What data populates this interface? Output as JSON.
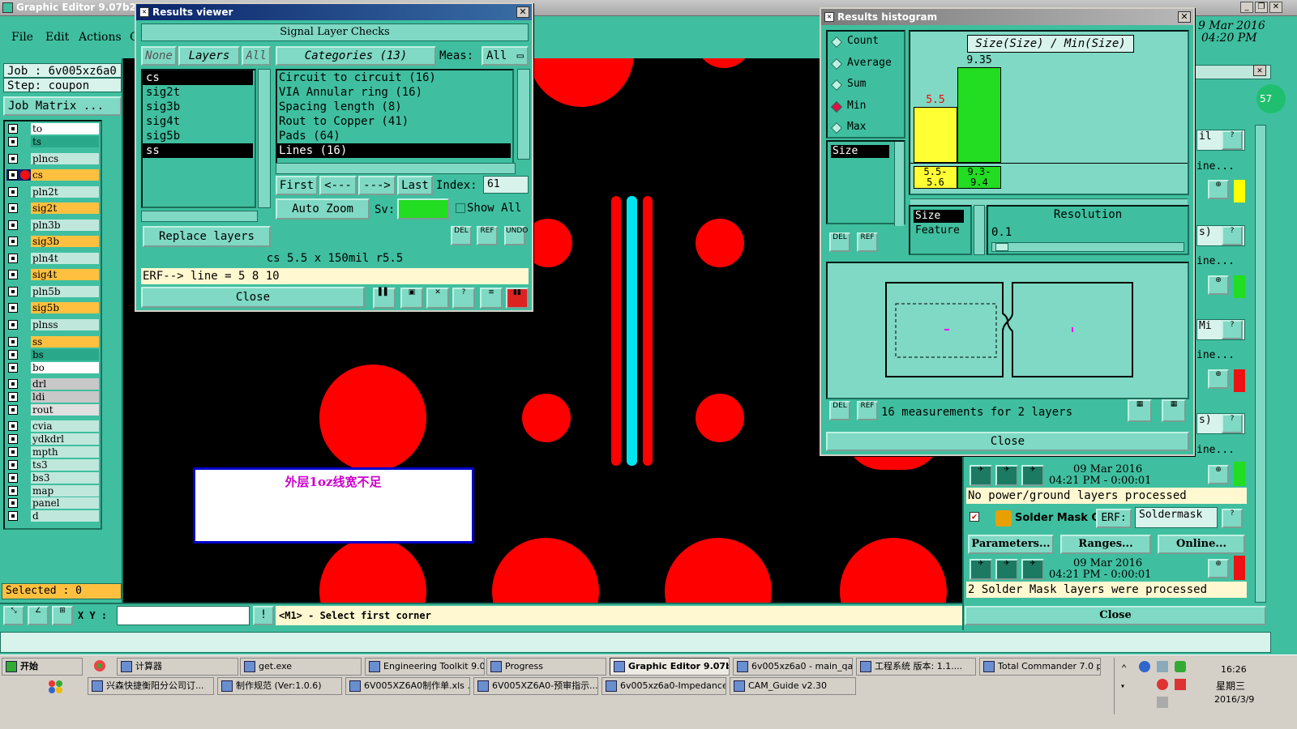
{
  "app": {
    "title": "Graphic Editor 9.07b2 (008",
    "menu": [
      "File",
      "Edit",
      "Actions",
      "C"
    ],
    "date": "9 Mar 2016",
    "time": "04:20 PM"
  },
  "left_panel": {
    "job": "Job : 6v005xz6a0",
    "step": "Step: coupon",
    "job_matrix": "Job Matrix ...",
    "layers": [
      {
        "name": "to",
        "color": "#ffffff"
      },
      {
        "name": "ts",
        "color": "#2aa88a"
      },
      {
        "name": "plncs",
        "color": "#bfe7dc"
      },
      {
        "name": "cs",
        "color": "#ffc040"
      },
      {
        "name": "pln2t",
        "color": "#bfe7dc"
      },
      {
        "name": "sig2t",
        "color": "#ffc040"
      },
      {
        "name": "pln3b",
        "color": "#bfe7dc"
      },
      {
        "name": "sig3b",
        "color": "#ffc040"
      },
      {
        "name": "pln4t",
        "color": "#bfe7dc"
      },
      {
        "name": "sig4t",
        "color": "#ffc040"
      },
      {
        "name": "pln5b",
        "color": "#bfe7dc"
      },
      {
        "name": "sig5b",
        "color": "#ffc040"
      },
      {
        "name": "plnss",
        "color": "#bfe7dc"
      },
      {
        "name": "ss",
        "color": "#ffc040"
      },
      {
        "name": "bs",
        "color": "#2aa88a"
      },
      {
        "name": "bo",
        "color": "#ffffff"
      },
      {
        "name": "drl",
        "color": "#c8c8c8"
      },
      {
        "name": "ldi",
        "color": "#c8c8c8"
      },
      {
        "name": "rout",
        "color": "#e0e0e0"
      },
      {
        "name": "cvia",
        "color": "#bfe7dc"
      },
      {
        "name": "ydkdrl",
        "color": "#bfe7dc"
      },
      {
        "name": "mpth",
        "color": "#bfe7dc"
      },
      {
        "name": "ts3",
        "color": "#bfe7dc"
      },
      {
        "name": "bs3",
        "color": "#bfe7dc"
      },
      {
        "name": "map",
        "color": "#bfe7dc"
      },
      {
        "name": "panel",
        "color": "#bfe7dc"
      },
      {
        "name": "d",
        "color": "#bfe7dc"
      }
    ],
    "selected": "Selected : 0"
  },
  "canvas": {
    "note_text": "外层1oz线宽不足"
  },
  "bottom": {
    "xy_label": "X Y :",
    "prompt": "<M1> - Select first corner"
  },
  "results_viewer": {
    "title": "Results viewer",
    "header": "Signal Layer Checks",
    "none_btn": "None",
    "layers_btn": "Layers",
    "all_btn": "All",
    "categories_btn": "Categories (13)",
    "meas_label": "Meas:",
    "meas_value": "All",
    "layer_list": [
      "cs",
      "sig2t",
      "sig3b",
      "sig4t",
      "sig5b",
      "ss"
    ],
    "categories": [
      "Circuit to circuit (16)",
      "VIA Annular ring (16)",
      "Spacing length (8)",
      "Rout to Copper (41)",
      "Pads (64)",
      "Lines (16)"
    ],
    "first_btn": "First",
    "prev_btn": "<---",
    "next_btn": "--->",
    "last_btn": "Last",
    "index_label": "Index:",
    "index_value": "61",
    "auto_zoom": "Auto Zoom",
    "sv_label": "Sv:",
    "show_all": "Show All",
    "replace_layers": "Replace layers",
    "del": "DEL",
    "ref": "REF",
    "undo": "UNDO",
    "status": "cs 5.5 x 150mil  r5.5",
    "erf": "ERF--> line = 5 8 10",
    "close": "Close"
  },
  "histogram": {
    "title": "Results histogram",
    "options": [
      "Count",
      "Average",
      "Sum",
      "Min",
      "Max"
    ],
    "selected_option": "Min",
    "chart_title": "Size(Size) / Min(Size)",
    "size_item": "Size",
    "bars": [
      {
        "value": "5.5",
        "range": "5.5-5.6",
        "color": "#ffff33",
        "label_color": "#ff0000"
      },
      {
        "value": "9.35",
        "range": "9.3-9.4",
        "color": "#22dd22",
        "label_color": "#000000"
      }
    ],
    "resolution_label": "Resolution",
    "resolution_value": "0.1",
    "list2": [
      "Size",
      "Feature"
    ],
    "measurements": "16 measurements for 2 layers",
    "close": "Close",
    "del": "DEL",
    "ref": "REF"
  },
  "checklist": {
    "row1_label": "il",
    "row1_link": "ine...",
    "row2_label": "s)",
    "row2_link": "ine...",
    "row3_label": "Mi",
    "row3_link": "ine...",
    "row4_label": "s)",
    "row4_link": "ine...",
    "date1": "09 Mar 2016",
    "time1": "04:21 PM - 0:00:01",
    "msg1": "No power/ground layers processed",
    "solder_label": "Solder Mask Ch",
    "erf_label": "ERF:",
    "erf_value": "Soldermask",
    "parameters": "Parameters...",
    "ranges": "Ranges...",
    "online": "Online...",
    "date2": "09 Mar 2016",
    "time2": "04:21 PM - 0:00:01",
    "msg2": "2 Solder Mask layers were processed",
    "close": "Close",
    "badge": "57"
  },
  "taskbar": {
    "start": "开始",
    "row1": [
      "计算器",
      "get.exe",
      "Engineering Toolkit 9.0...",
      "Progress",
      "Graphic Editor 9.07b...",
      "6v005xz6a0 - main_qa",
      "工程系统  版本: 1.1....",
      "Total Commander 7.0 p..."
    ],
    "row2": [
      "兴森快捷衡阳分公司订...",
      "制作规范 (Ver:1.0.6)",
      "6V005XZ6A0制作单.xls ...",
      "6V005XZ6A0-预审指示....",
      "6v005xz6a0-Impedance ...",
      "CAM_Guide v2.30"
    ],
    "clock": "16:26",
    "weekday": "星期三",
    "date": "2016/3/9"
  }
}
